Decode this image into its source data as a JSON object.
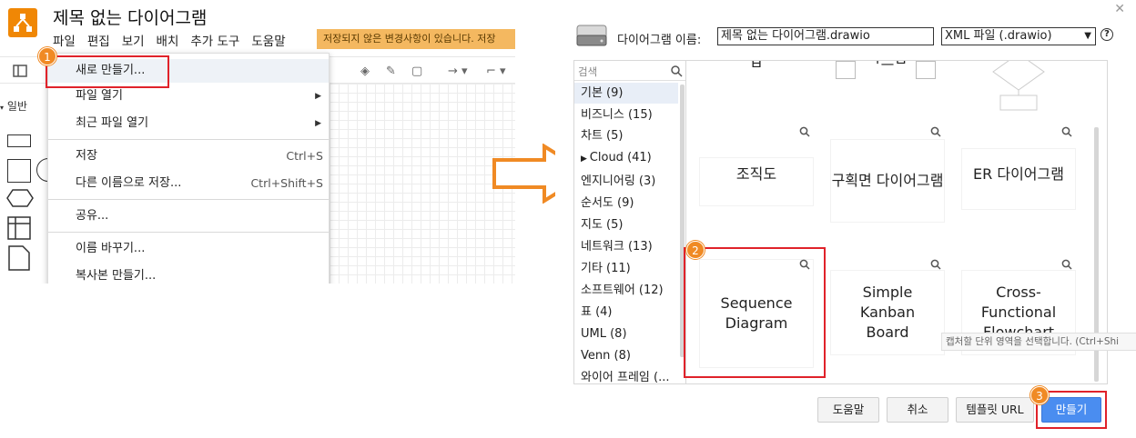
{
  "editor": {
    "title": "제목 없는 다이어그램",
    "menus": [
      "파일",
      "편집",
      "보기",
      "배치",
      "추가 도구",
      "도움말"
    ],
    "unsaved_notice": "저장되지 않은 변경사항이 있습니다. 저장",
    "section_general": "일반"
  },
  "file_menu": {
    "items": [
      {
        "label": "새로 만들기...",
        "shortcut": "",
        "submenu": false
      },
      {
        "label": "파일 열기",
        "shortcut": "",
        "submenu": true
      },
      {
        "label": "최근 파일 열기",
        "shortcut": "",
        "submenu": true
      },
      {
        "label": "저장",
        "shortcut": "Ctrl+S",
        "submenu": false
      },
      {
        "label": "다른 이름으로 저장...",
        "shortcut": "Ctrl+Shift+S",
        "submenu": false
      },
      {
        "label": "공유...",
        "shortcut": "",
        "submenu": false
      },
      {
        "label": "이름 바꾸기...",
        "shortcut": "",
        "submenu": false
      },
      {
        "label": "복사본 만들기...",
        "shortcut": "",
        "submenu": false
      }
    ]
  },
  "steps": {
    "one": "1",
    "two": "2",
    "three": "3"
  },
  "dialog": {
    "filename_label": "다이어그램 이름:",
    "filename_value": "제목 없는 다이어그램.drawio",
    "filetype_value": "XML 파일 (.drawio)",
    "search_placeholder": "검색",
    "categories": [
      "기본 (9)",
      "비즈니스 (15)",
      "차트 (5)",
      "Cloud (41)",
      "엔지니어링 (3)",
      "순서도 (9)",
      "지도 (5)",
      "네트워크 (13)",
      "기타 (11)",
      "소프트웨어 (12)",
      "표 (4)",
      "UML (8)",
      "Venn (8)",
      "와이어 프레임 (..."
    ],
    "templates_row_top_partial": [
      "ㅂ",
      "ㄱ드ㅂ"
    ],
    "templates": [
      {
        "label": "조직도"
      },
      {
        "label": "구획면 다이어그램"
      },
      {
        "label": "ER 다이어그램"
      },
      {
        "label": "Sequence Diagram"
      },
      {
        "label": "Simple Kanban Board"
      },
      {
        "label": "Cross-Functional Flowchart"
      }
    ],
    "tooltip": "캡처할 단위 영역을 선택합니다. (Ctrl+Shi",
    "buttons": {
      "help": "도움말",
      "cancel": "취소",
      "template_url": "템플릿 URL",
      "create": "만들기"
    }
  },
  "colors": {
    "accent": "#f08705",
    "highlight": "#e0222a",
    "primary_button": "#4a8df0",
    "arrow": "#f08a24"
  }
}
